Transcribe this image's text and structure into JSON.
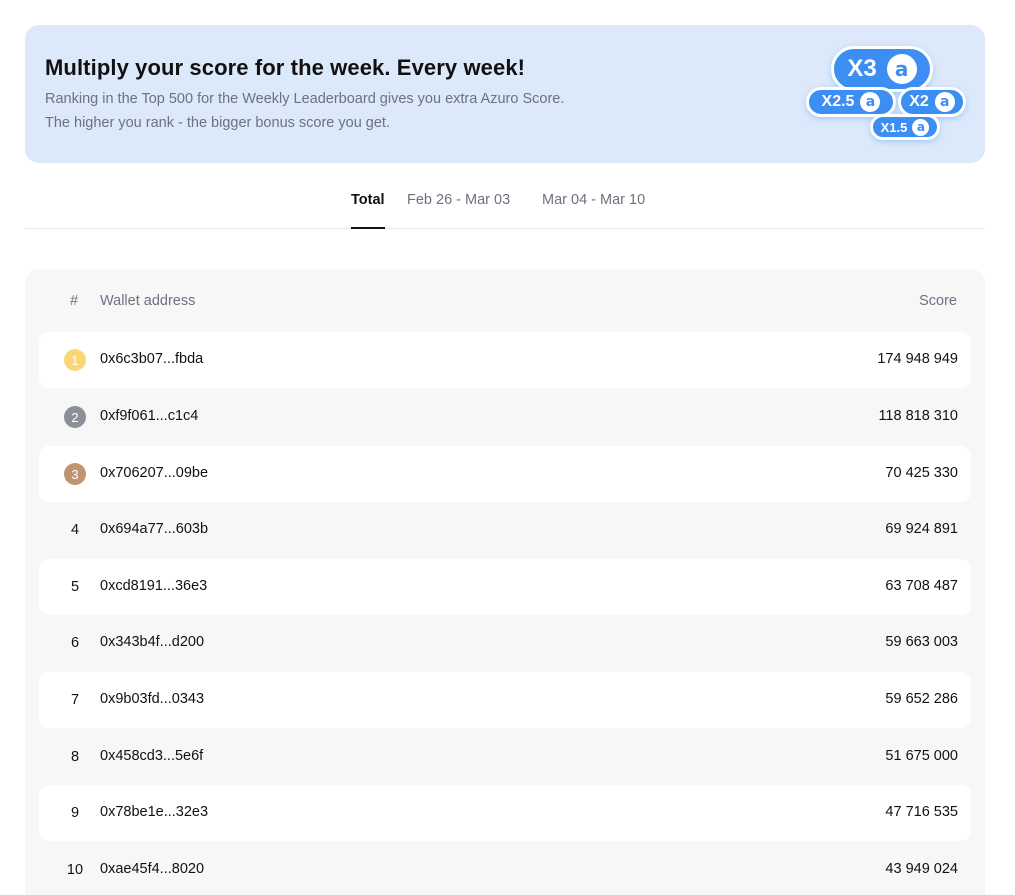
{
  "banner": {
    "title": "Multiply your score for the week. Every week!",
    "line1": "Ranking in the Top 500 for the Weekly Leaderboard gives you extra Azuro Score.",
    "line2": "The higher you rank - the bigger bonus score you get.",
    "multipliers": [
      "X3",
      "X2.5",
      "X2",
      "X1.5"
    ],
    "logo_glyph": "a",
    "accent": "#3d8ef3",
    "background": "#dce9fb"
  },
  "tabs": [
    {
      "label": "Total",
      "active": true
    },
    {
      "label": "Feb 26 - Mar 03",
      "active": false
    },
    {
      "label": "Mar 04 - Mar 10",
      "active": false
    }
  ],
  "table": {
    "headers": {
      "rank": "#",
      "wallet": "Wallet address",
      "score": "Score"
    },
    "rows": [
      {
        "rank": "1",
        "wallet": "0x6c3b07...fbda",
        "score": "174 948 949",
        "medal": "gold"
      },
      {
        "rank": "2",
        "wallet": "0xf9f061...c1c4",
        "score": "118 818 310",
        "medal": "silver"
      },
      {
        "rank": "3",
        "wallet": "0x706207...09be",
        "score": "70 425 330",
        "medal": "bronze"
      },
      {
        "rank": "4",
        "wallet": "0x694a77...603b",
        "score": "69 924 891"
      },
      {
        "rank": "5",
        "wallet": "0xcd8191...36e3",
        "score": "63 708 487"
      },
      {
        "rank": "6",
        "wallet": "0x343b4f...d200",
        "score": "59 663 003"
      },
      {
        "rank": "7",
        "wallet": "0x9b03fd...0343",
        "score": "59 652 286"
      },
      {
        "rank": "8",
        "wallet": "0x458cd3...5e6f",
        "score": "51 675 000"
      },
      {
        "rank": "9",
        "wallet": "0x78be1e...32e3",
        "score": "47 716 535"
      },
      {
        "rank": "10",
        "wallet": "0xae45f4...8020",
        "score": "43 949 024"
      }
    ]
  }
}
